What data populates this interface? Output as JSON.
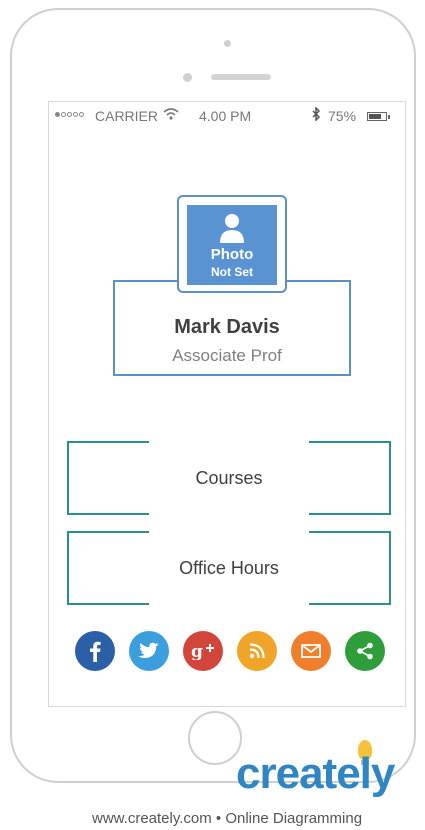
{
  "status_bar": {
    "carrier": "CARRIER",
    "time": "4.00 PM",
    "battery": "75%",
    "battery_level": 0.75
  },
  "profile": {
    "photo_line1": "Photo",
    "photo_line2": "Not Set",
    "name": "Mark Davis",
    "title": "Associate Prof"
  },
  "menu": {
    "courses": "Courses",
    "office_hours": "Office Hours"
  },
  "social": {
    "items": [
      {
        "icon": "facebook-icon",
        "glyph": "f",
        "color": "#2b5fa8"
      },
      {
        "icon": "twitter-icon",
        "glyph": "t",
        "color": "#3a9fdc"
      },
      {
        "icon": "google-plus-icon",
        "glyph": "g+",
        "color": "#d3443a"
      },
      {
        "icon": "rss-icon",
        "glyph": "rss",
        "color": "#f0a529"
      },
      {
        "icon": "email-icon",
        "glyph": "mail",
        "color": "#f07f2b"
      },
      {
        "icon": "share-icon",
        "glyph": "share",
        "color": "#2e9e3a"
      }
    ]
  },
  "colors": {
    "profile_border": "#5b8fc8",
    "photo_bg": "#5a93d2",
    "menu_border": "#2b908a"
  },
  "branding": {
    "logo": "creately",
    "footer": "www.creately.com • Online Diagramming"
  }
}
